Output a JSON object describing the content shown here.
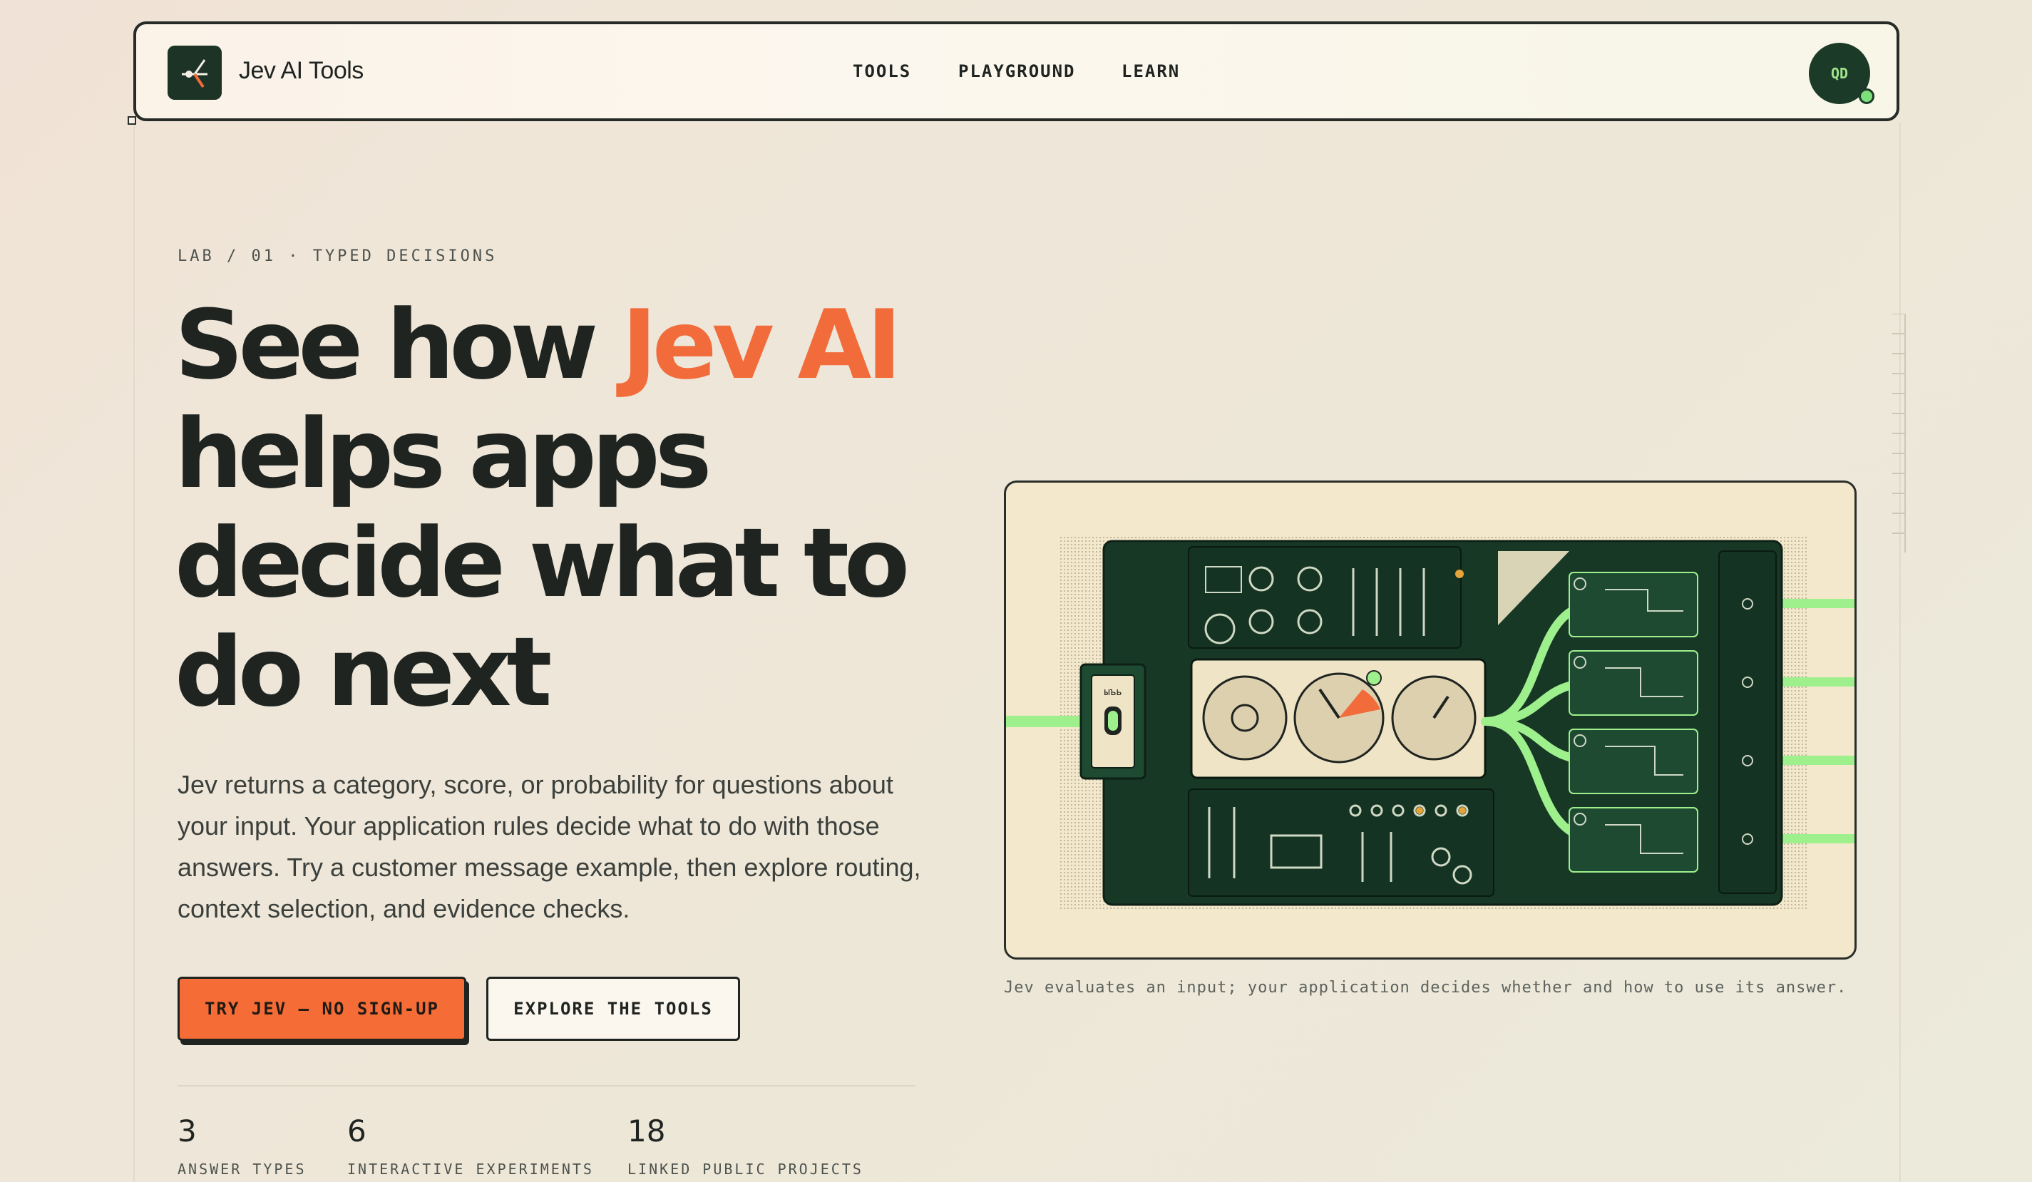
{
  "brand": {
    "name": "Jev AI Tools"
  },
  "nav": {
    "links": [
      "TOOLS",
      "PLAYGROUND",
      "LEARN"
    ]
  },
  "user": {
    "initials": "QD"
  },
  "hero": {
    "eyebrow": "LAB / 01 · TYPED DECISIONS",
    "headline": {
      "part1": "See how ",
      "accent": "Jev AI",
      "part2": " helps apps decide what to do next"
    },
    "description": "Jev returns a category, score, or probability for questions about your input. Your application rules decide what to do with those answers. Try a customer message example, then explore routing, context selection, and evidence checks.",
    "primary_cta": "TRY JEV — NO SIGN-UP",
    "secondary_cta": "EXPLORE THE TOOLS"
  },
  "stats": [
    {
      "value": "3",
      "label": "ANSWER TYPES"
    },
    {
      "value": "6",
      "label": "INTERACTIVE EXPERIMENTS"
    },
    {
      "value": "18",
      "label": "LINKED PUBLIC PROJECTS"
    }
  ],
  "illustration": {
    "caption": "Jev evaluates an input; your application decides whether and how to use its answer.",
    "input_module_label": "ыъь",
    "colors": {
      "panel": "#183826",
      "wire": "#9ef08d",
      "accent": "#f26b3a",
      "paper": "#f3e8cb"
    }
  },
  "colors": {
    "accent": "#f26b3a",
    "ink": "#1f2421",
    "background": "#ede7d8"
  }
}
